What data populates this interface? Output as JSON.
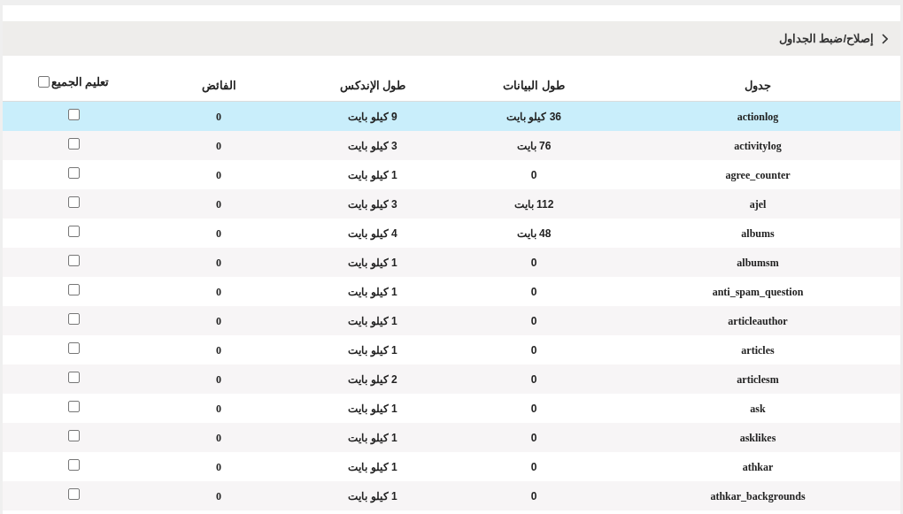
{
  "header": {
    "title": "إصلاح/ضبط الجداول"
  },
  "table": {
    "columns": [
      "جدول",
      "طول البيانات",
      "طول الإندكس",
      "الفائض"
    ],
    "select_all": {
      "label": "تعليم الجميع",
      "checked": false
    },
    "rows": [
      {
        "name": "actionlog",
        "data_length": "36 كيلو بايت",
        "index_length": "9 كيلو بايت",
        "overhead": "0",
        "checked": false,
        "selected": true
      },
      {
        "name": "activitylog",
        "data_length": "76 بايت",
        "index_length": "3 كيلو بايت",
        "overhead": "0",
        "checked": false,
        "selected": false
      },
      {
        "name": "agree_counter",
        "data_length": "0",
        "index_length": "1 كيلو بايت",
        "overhead": "0",
        "checked": false,
        "selected": false
      },
      {
        "name": "ajel",
        "data_length": "112 بايت",
        "index_length": "3 كيلو بايت",
        "overhead": "0",
        "checked": false,
        "selected": false
      },
      {
        "name": "albums",
        "data_length": "48 بايت",
        "index_length": "4 كيلو بايت",
        "overhead": "0",
        "checked": false,
        "selected": false
      },
      {
        "name": "albumsm",
        "data_length": "0",
        "index_length": "1 كيلو بايت",
        "overhead": "0",
        "checked": false,
        "selected": false
      },
      {
        "name": "anti_spam_question",
        "data_length": "0",
        "index_length": "1 كيلو بايت",
        "overhead": "0",
        "checked": false,
        "selected": false
      },
      {
        "name": "articleauthor",
        "data_length": "0",
        "index_length": "1 كيلو بايت",
        "overhead": "0",
        "checked": false,
        "selected": false
      },
      {
        "name": "articles",
        "data_length": "0",
        "index_length": "1 كيلو بايت",
        "overhead": "0",
        "checked": false,
        "selected": false
      },
      {
        "name": "articlesm",
        "data_length": "0",
        "index_length": "2 كيلو بايت",
        "overhead": "0",
        "checked": false,
        "selected": false
      },
      {
        "name": "ask",
        "data_length": "0",
        "index_length": "1 كيلو بايت",
        "overhead": "0",
        "checked": false,
        "selected": false
      },
      {
        "name": "asklikes",
        "data_length": "0",
        "index_length": "1 كيلو بايت",
        "overhead": "0",
        "checked": false,
        "selected": false
      },
      {
        "name": "athkar",
        "data_length": "0",
        "index_length": "1 كيلو بايت",
        "overhead": "0",
        "checked": false,
        "selected": false
      },
      {
        "name": "athkar_backgrounds",
        "data_length": "0",
        "index_length": "1 كيلو بايت",
        "overhead": "0",
        "checked": false,
        "selected": false
      }
    ]
  }
}
